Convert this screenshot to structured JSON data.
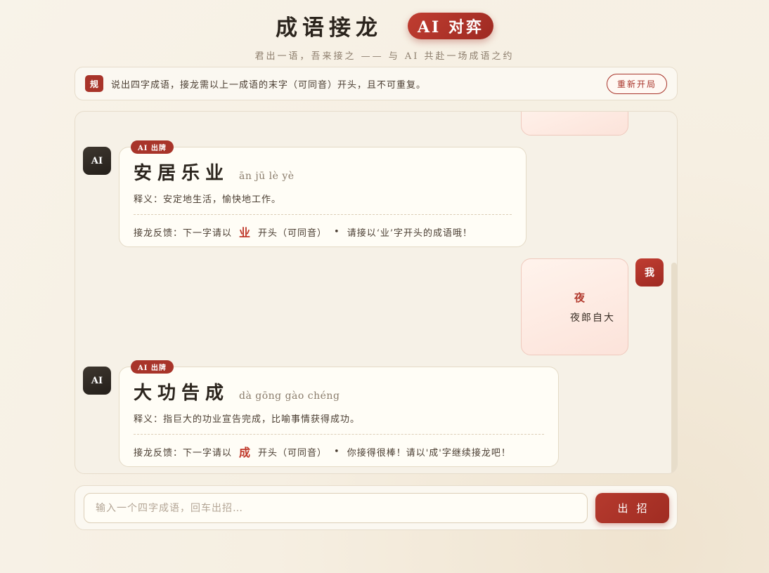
{
  "header": {
    "title": "成语接龙",
    "ai_badge": "AI 对弈",
    "subtitle": "君出一语，吾来接之 —— 与 AI 共赴一场成语之约"
  },
  "rules": {
    "badge": "规",
    "text": "说出四字成语，接龙需以上一成语的末字（可同音）开头，且不可重复。",
    "restart_label": "重新开局"
  },
  "chat": {
    "messages": [
      {
        "sender": "AI",
        "tag": "AI 出牌",
        "idiom": "安居乐业",
        "pinyin": "ān jū lè yè",
        "meaning": "释义：安定地生活，愉快地工作。",
        "feedback_prefix": "接龙反馈：下一字请以",
        "next_char": "业",
        "feedback_suffix": "开头（可同音）",
        "separator": "•",
        "comment": "请接以‘业’字开头的成语哦！"
      },
      {
        "sender": "我",
        "char": "夜",
        "idiom": "夜郎自大"
      },
      {
        "sender": "AI",
        "tag": "AI 出牌",
        "idiom": "大功告成",
        "pinyin": "dà gōng gào chéng",
        "meaning": "释义：指巨大的功业宣告完成，比喻事情获得成功。",
        "feedback_prefix": "接龙反馈：下一字请以",
        "next_char": "成",
        "feedback_suffix": "开头（可同音）",
        "separator": "•",
        "comment": "你接得很棒！请以'成'字继续接龙吧！"
      }
    ]
  },
  "input": {
    "placeholder": "输入一个四字成语，回车出招…",
    "value": "",
    "submit_label": "出招"
  },
  "colors": {
    "accent": "#a8342a",
    "next_char": "#c0392b",
    "background": "#f6efe2"
  }
}
